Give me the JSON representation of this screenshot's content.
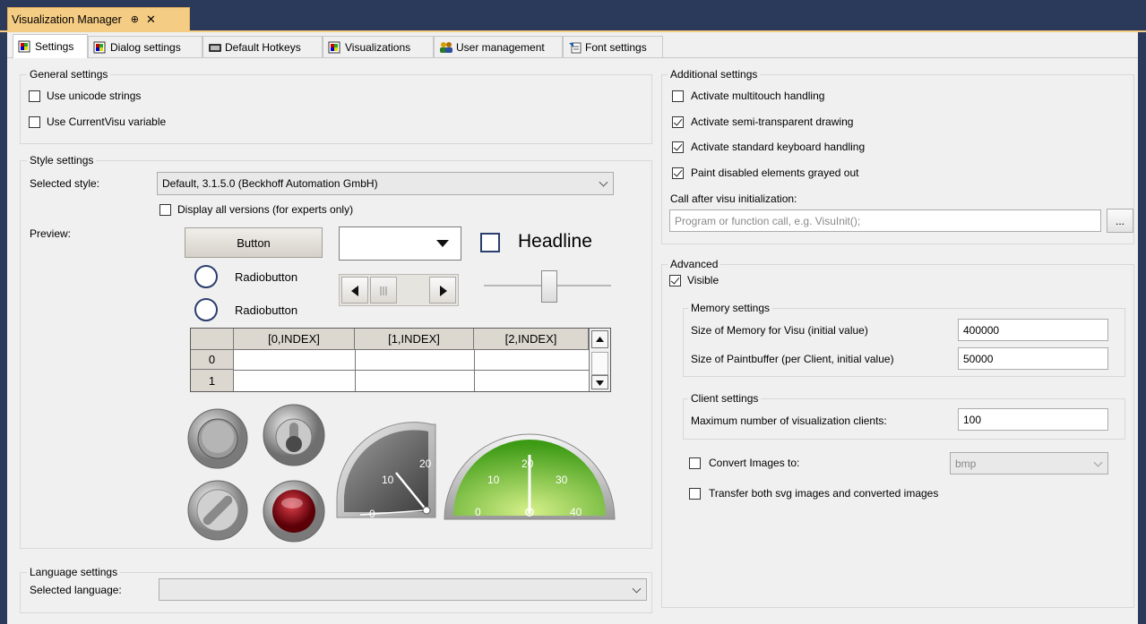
{
  "window": {
    "title": "Visualization Manager",
    "pin_glyph": "⊕",
    "close_glyph": "✕"
  },
  "tabs": [
    {
      "label": "Settings",
      "icon": "settings-icon"
    },
    {
      "label": "Dialog settings",
      "icon": "dialog-icon"
    },
    {
      "label": "Default Hotkeys",
      "icon": "keyboard-icon"
    },
    {
      "label": "Visualizations",
      "icon": "visualization-icon"
    },
    {
      "label": "User management",
      "icon": "users-icon"
    },
    {
      "label": "Font settings",
      "icon": "font-icon"
    }
  ],
  "general": {
    "title": "General settings",
    "use_unicode": {
      "label": "Use unicode strings",
      "checked": false
    },
    "use_currentvisu": {
      "label": "Use CurrentVisu variable",
      "checked": false
    }
  },
  "style": {
    "title": "Style settings",
    "selected_label": "Selected style:",
    "selected_value": "Default, 3.1.5.0 (Beckhoff Automation GmbH)",
    "display_all": {
      "label": "Display all versions (for experts only)",
      "checked": false
    },
    "preview_label": "Preview:"
  },
  "preview": {
    "button_label": "Button",
    "headline": "Headline",
    "radio1": "Radiobutton",
    "radio2": "Radiobutton",
    "table_headers": [
      "[0,INDEX]",
      "[1,INDEX]",
      "[2,INDEX]"
    ],
    "table_rows": [
      "0",
      "1"
    ],
    "gauge1_ticks": [
      "0",
      "10",
      "20"
    ],
    "gauge2_ticks": [
      "0",
      "10",
      "20",
      "30",
      "40"
    ]
  },
  "language": {
    "title": "Language settings",
    "selected_label": "Selected language:",
    "selected_value": ""
  },
  "additional": {
    "title": "Additional settings",
    "multitouch": {
      "label": "Activate multitouch handling",
      "checked": false
    },
    "semitransparent": {
      "label": "Activate semi-transparent drawing",
      "checked": true
    },
    "keyboard": {
      "label": "Activate standard keyboard handling",
      "checked": true
    },
    "paint_disabled": {
      "label": "Paint disabled elements grayed out",
      "checked": true
    },
    "call_after_label": "Call after visu initialization:",
    "call_after_placeholder": "Program or function call, e.g. VisuInit();",
    "browse_label": "..."
  },
  "advanced": {
    "title": "Advanced",
    "visible": {
      "label": "Visible",
      "checked": true
    },
    "memory": {
      "title": "Memory settings",
      "visu_label": "Size of Memory for Visu (initial value)",
      "visu_value": "400000",
      "paint_label": "Size of Paintbuffer (per Client, initial value)",
      "paint_value": "50000"
    },
    "client": {
      "title": "Client settings",
      "max_label": "Maximum number of visualization clients:",
      "max_value": "100"
    },
    "convert": {
      "label": "Convert Images to:",
      "checked": false,
      "format": "bmp"
    },
    "transfer": {
      "label": "Transfer both svg images and converted images",
      "checked": false
    }
  }
}
